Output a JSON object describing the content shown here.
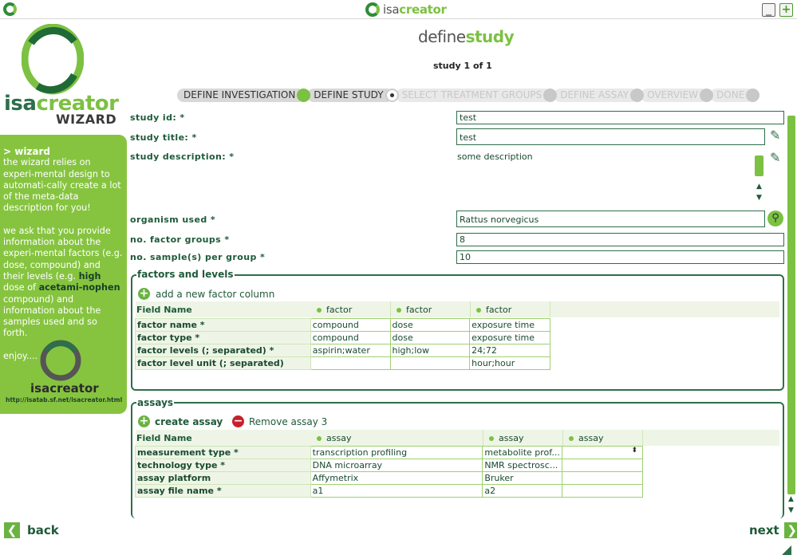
{
  "window": {
    "app_name": "isacreator",
    "minimize_label": "_",
    "maximize_label": "+"
  },
  "logo": {
    "name": "isacreator",
    "subtitle": "WIZARD"
  },
  "sidebar": {
    "heading": "> wizard",
    "para1": "the wizard relies on experi-mental design to automati-cally create a lot of the meta-data description for you!",
    "para2_a": "we ask that you provide information about the experi-mental factors (e.g. dose, compound) and their levels (e.g. ",
    "para2_high": "high",
    "para2_b": " dose of ",
    "para2_acet": "acetami-nophen",
    "para2_c": " compound) and information about the samples used and so forth.",
    "enjoy": "enjoy....",
    "small_logo": "isacreator",
    "url": "http://isatab.sf.net/isacreator.html"
  },
  "header": {
    "title_prefix": "define",
    "title_suffix": "study",
    "step": "study 1 of 1"
  },
  "breadcrumb": [
    "DEFINE INVESTIGATION",
    "DEFINE STUDY",
    "SELECT TREATMENT GROUPS",
    "DEFINE ASSAY",
    "OVERVIEW",
    "DONE"
  ],
  "form": {
    "study_id_label": "study id: *",
    "study_id": "test",
    "study_title_label": "study title: *",
    "study_title": "test",
    "study_description_label": "study description: *",
    "study_description": "some description",
    "organism_label": "organism used *",
    "organism": "Rattus norvegicus",
    "factor_groups_label": "no. factor groups *",
    "factor_groups": "8",
    "samples_label": "no. sample(s) per group *",
    "samples": "10"
  },
  "factors": {
    "section_title": "factors and levels",
    "add_label": "add a new factor column",
    "field_name_header": "Field Name",
    "columns": [
      "factor",
      "factor",
      "factor"
    ],
    "rows": [
      {
        "name": "factor name *",
        "values": [
          "compound",
          "dose",
          "exposure time"
        ]
      },
      {
        "name": "factor type *",
        "values": [
          "compound",
          "dose",
          "exposure time"
        ]
      },
      {
        "name": "factor levels (; separated) *",
        "values": [
          "aspirin;water",
          "high;low",
          "24;72"
        ]
      },
      {
        "name": "factor level unit (; separated)",
        "values": [
          "",
          "",
          "hour;hour"
        ]
      }
    ]
  },
  "assays": {
    "section_title": "assays",
    "create_label": "create assay",
    "remove_label": "Remove assay 3",
    "field_name_header": "Field Name",
    "columns": [
      "assay",
      "assay",
      "assay"
    ],
    "rows": [
      {
        "name": "measurement type *",
        "values": [
          "transcription profiling",
          "metabolite prof...",
          ""
        ]
      },
      {
        "name": "technology type *",
        "values": [
          "DNA microarray",
          "NMR spectrosc...",
          ""
        ]
      },
      {
        "name": "assay platform",
        "values": [
          "Affymetrix",
          "Bruker",
          ""
        ]
      },
      {
        "name": "assay file name *",
        "values": [
          "a1",
          "a2",
          ""
        ]
      }
    ]
  },
  "nav": {
    "back": "back",
    "next": "next"
  },
  "colors": {
    "accent_green": "#7cc142",
    "dark_green": "#1f5a3a",
    "remove_red": "#c8202d"
  }
}
